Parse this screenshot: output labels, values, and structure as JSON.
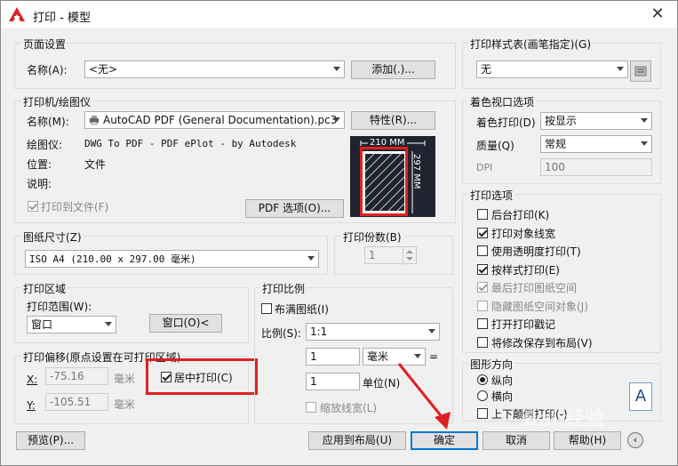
{
  "window": {
    "title": "打印 - 模型",
    "close_glyph": "✕"
  },
  "page_setup": {
    "group_label": "页面设置",
    "name_label": "名称(A):",
    "name_value": "<无>",
    "add_button": "添加(.)..."
  },
  "printer": {
    "group_label": "打印机/绘图仪",
    "name_label": "名称(M):",
    "name_value": "AutoCAD PDF (General Documentation).pc3",
    "properties_button": "特性(R)...",
    "plotter_label": "绘图仪:",
    "plotter_value": "DWG To PDF - PDF ePlot - by Autodesk",
    "location_label": "位置:",
    "location_value": "文件",
    "description_label": "说明:",
    "print_to_file": "打印到文件(F)",
    "pdf_options_button": "PDF 选项(O)...",
    "preview_width": "210 MM",
    "preview_height": "297 MM"
  },
  "paper_size": {
    "group_label": "图纸尺寸(Z)",
    "value": "ISO A4 (210.00 x 297.00 毫米)"
  },
  "copies": {
    "group_label": "打印份数(B)",
    "value": "1"
  },
  "plot_area": {
    "group_label": "打印区域",
    "range_label": "打印范围(W):",
    "range_value": "窗口",
    "window_button": "窗口(O)<"
  },
  "plot_offset": {
    "group_label": "打印偏移(原点设置在可打印区域)",
    "x_label": "X:",
    "x_value": "-75.16",
    "y_label": "Y:",
    "y_value": "-105.51",
    "unit": "毫米",
    "center_plot": "居中打印(C)"
  },
  "plot_scale": {
    "group_label": "打印比例",
    "fit_to_paper": "布满图纸(I)",
    "scale_label": "比例(S):",
    "scale_value": "1:1",
    "value1": "1",
    "unit_value": "毫米",
    "equals": "=",
    "value2": "1",
    "unit_label": "单位(N)",
    "scale_lineweights": "缩放线宽(L)"
  },
  "plot_style": {
    "group_label": "打印样式表(画笔指定)(G)",
    "value": "无"
  },
  "shaded_viewport": {
    "group_label": "着色视口选项",
    "shade_label": "着色打印(D)",
    "shade_value": "按显示",
    "quality_label": "质量(Q)",
    "quality_value": "常规",
    "dpi_label": "DPI",
    "dpi_value": "100"
  },
  "plot_options": {
    "group_label": "打印选项",
    "items": [
      {
        "label": "后台打印(K)",
        "checked": false,
        "disabled": false
      },
      {
        "label": "打印对象线宽",
        "checked": true,
        "disabled": false
      },
      {
        "label": "使用透明度打印(T)",
        "checked": false,
        "disabled": false
      },
      {
        "label": "按样式打印(E)",
        "checked": true,
        "disabled": false
      },
      {
        "label": "最后打印图纸空间",
        "checked": true,
        "disabled": true
      },
      {
        "label": "隐藏图纸空间对象(J)",
        "checked": false,
        "disabled": true
      },
      {
        "label": "打开打印戳记",
        "checked": false,
        "disabled": false
      },
      {
        "label": "将修改保存到布局(V)",
        "checked": false,
        "disabled": false
      }
    ]
  },
  "orientation": {
    "group_label": "图形方向",
    "portrait": "纵向",
    "landscape": "横向",
    "upside_down": "上下颠倒打印(-)",
    "icon_letter": "A"
  },
  "footer": {
    "preview_button": "预览(P)...",
    "apply_layout_button": "应用到布局(U)",
    "ok_button": "确定",
    "cancel_button": "取消",
    "help_button": "帮助(H)"
  },
  "watermark": "Bai 经验",
  "colors": {
    "highlight": "#e02020",
    "accent": "#0078d7",
    "preview_bg": "#1f2430"
  }
}
